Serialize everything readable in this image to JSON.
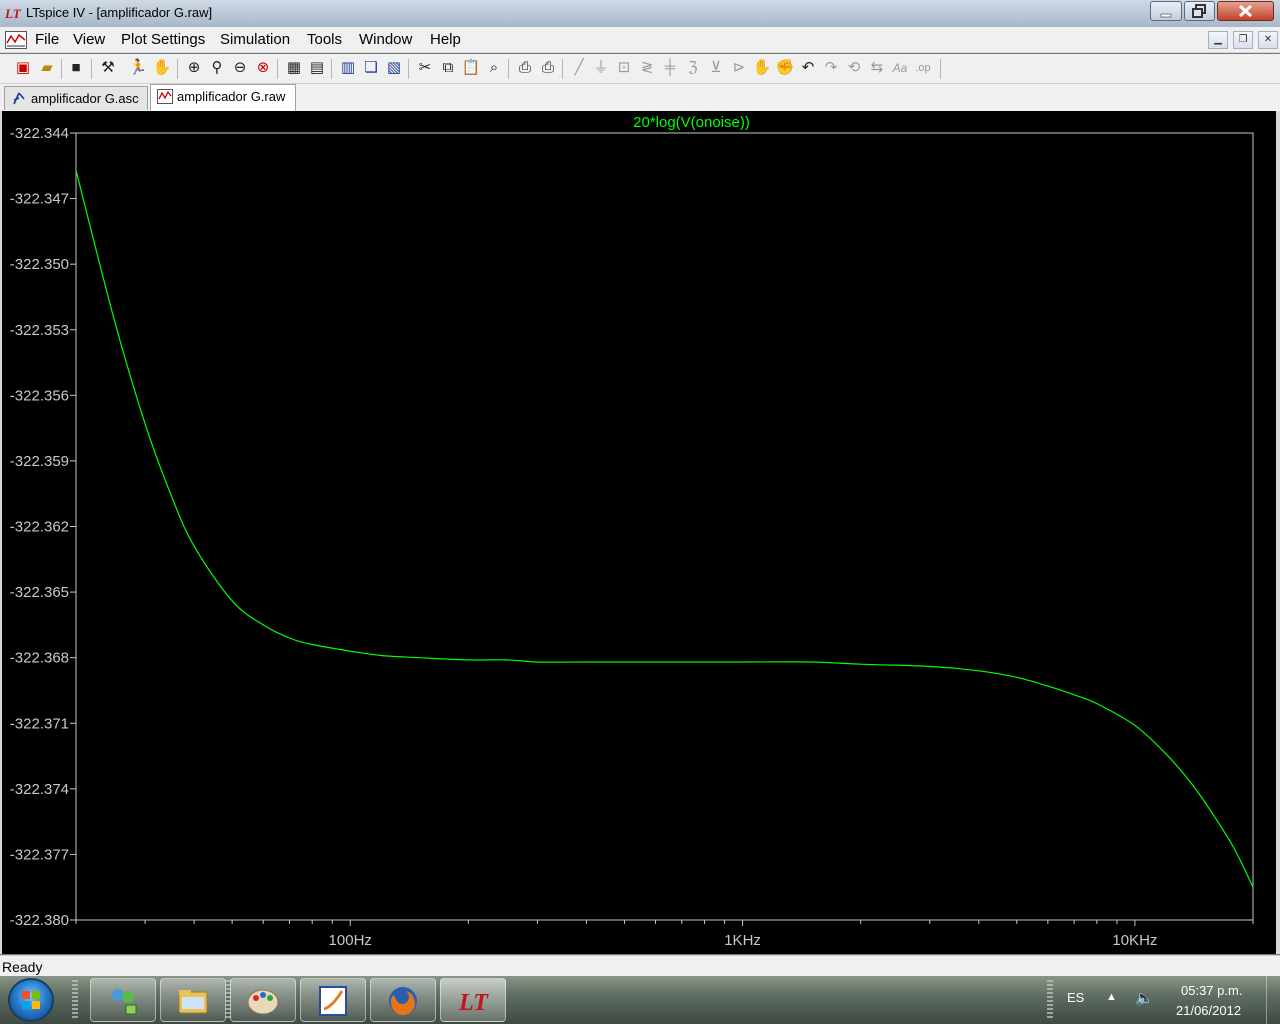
{
  "window": {
    "title": "LTspice IV - [amplificador G.raw]"
  },
  "menu": [
    "File",
    "View",
    "Plot Settings",
    "Simulation",
    "Tools",
    "Window",
    "Help"
  ],
  "tabs": [
    {
      "label": "amplificador G.asc",
      "active": false
    },
    {
      "label": "amplificador G.raw",
      "active": true
    }
  ],
  "toolbar_icons": [
    "new-schematic-icon",
    "open-icon",
    "save-icon",
    "control-panel-icon",
    "run-icon",
    "pan-icon",
    "zoom-in-icon",
    "zoom-area-icon",
    "zoom-out-icon",
    "zoom-cancel-icon",
    "autorange-icon",
    "add-trace-icon",
    "tile-horizontal-icon",
    "cascade-icon",
    "tile-vertical-icon",
    "cut-icon",
    "copy-icon",
    "paste-icon",
    "find-icon",
    "print-preview-icon",
    "print-icon",
    "wire-icon",
    "ground-icon",
    "label-icon",
    "resistor-icon",
    "capacitor-icon",
    "inductor-icon",
    "diode-icon",
    "component-icon",
    "move-icon",
    "drag-icon",
    "undo-icon",
    "redo-icon",
    "rotate-icon",
    "mirror-icon",
    "text-icon",
    "spice-directive-icon"
  ],
  "chart_data": {
    "type": "line",
    "title": "20*log(V(onoise))",
    "xlabel": "",
    "ylabel": "",
    "xscale": "log",
    "xlim": [
      20,
      20000
    ],
    "ylim": [
      -322.38,
      -322.344
    ],
    "x_ticks": [
      "100Hz",
      "1KHz",
      "10KHz"
    ],
    "y_ticks": [
      "-322.344",
      "-322.347",
      "-322.350",
      "-322.353",
      "-322.356",
      "-322.359",
      "-322.362",
      "-322.365",
      "-322.368",
      "-322.371",
      "-322.374",
      "-322.377",
      "-322.380"
    ],
    "grid": false,
    "color": "#00ff00",
    "series": [
      {
        "x": [
          20,
          25,
          30,
          35,
          40,
          50,
          60,
          70,
          80,
          100,
          120,
          150,
          200,
          250,
          300,
          400,
          500,
          700,
          1000,
          1500,
          2000,
          3000,
          4000,
          5000,
          6000,
          7000,
          8000,
          10000,
          12000,
          14000,
          16000,
          18000,
          20000
        ],
        "y": [
          -322.3457,
          -322.3525,
          -322.3573,
          -322.3606,
          -322.3629,
          -322.3654,
          -322.3665,
          -322.3671,
          -322.3674,
          -322.3677,
          -322.3679,
          -322.368,
          -322.3681,
          -322.3681,
          -322.3682,
          -322.3682,
          -322.3682,
          -322.3682,
          -322.3682,
          -322.3682,
          -322.3683,
          -322.3684,
          -322.3686,
          -322.3689,
          -322.3693,
          -322.3697,
          -322.3701,
          -322.3711,
          -322.3724,
          -322.3738,
          -322.3753,
          -322.3768,
          -322.3785
        ]
      }
    ]
  },
  "status": "Ready",
  "taskbar": {
    "language": "ES",
    "time": "05:37 p.m.",
    "date": "21/06/2012",
    "apps": [
      "network-app-icon",
      "explorer-icon",
      "paint-icon",
      "ltspice-doc-icon",
      "firefox-icon",
      "ltspice-icon"
    ]
  }
}
